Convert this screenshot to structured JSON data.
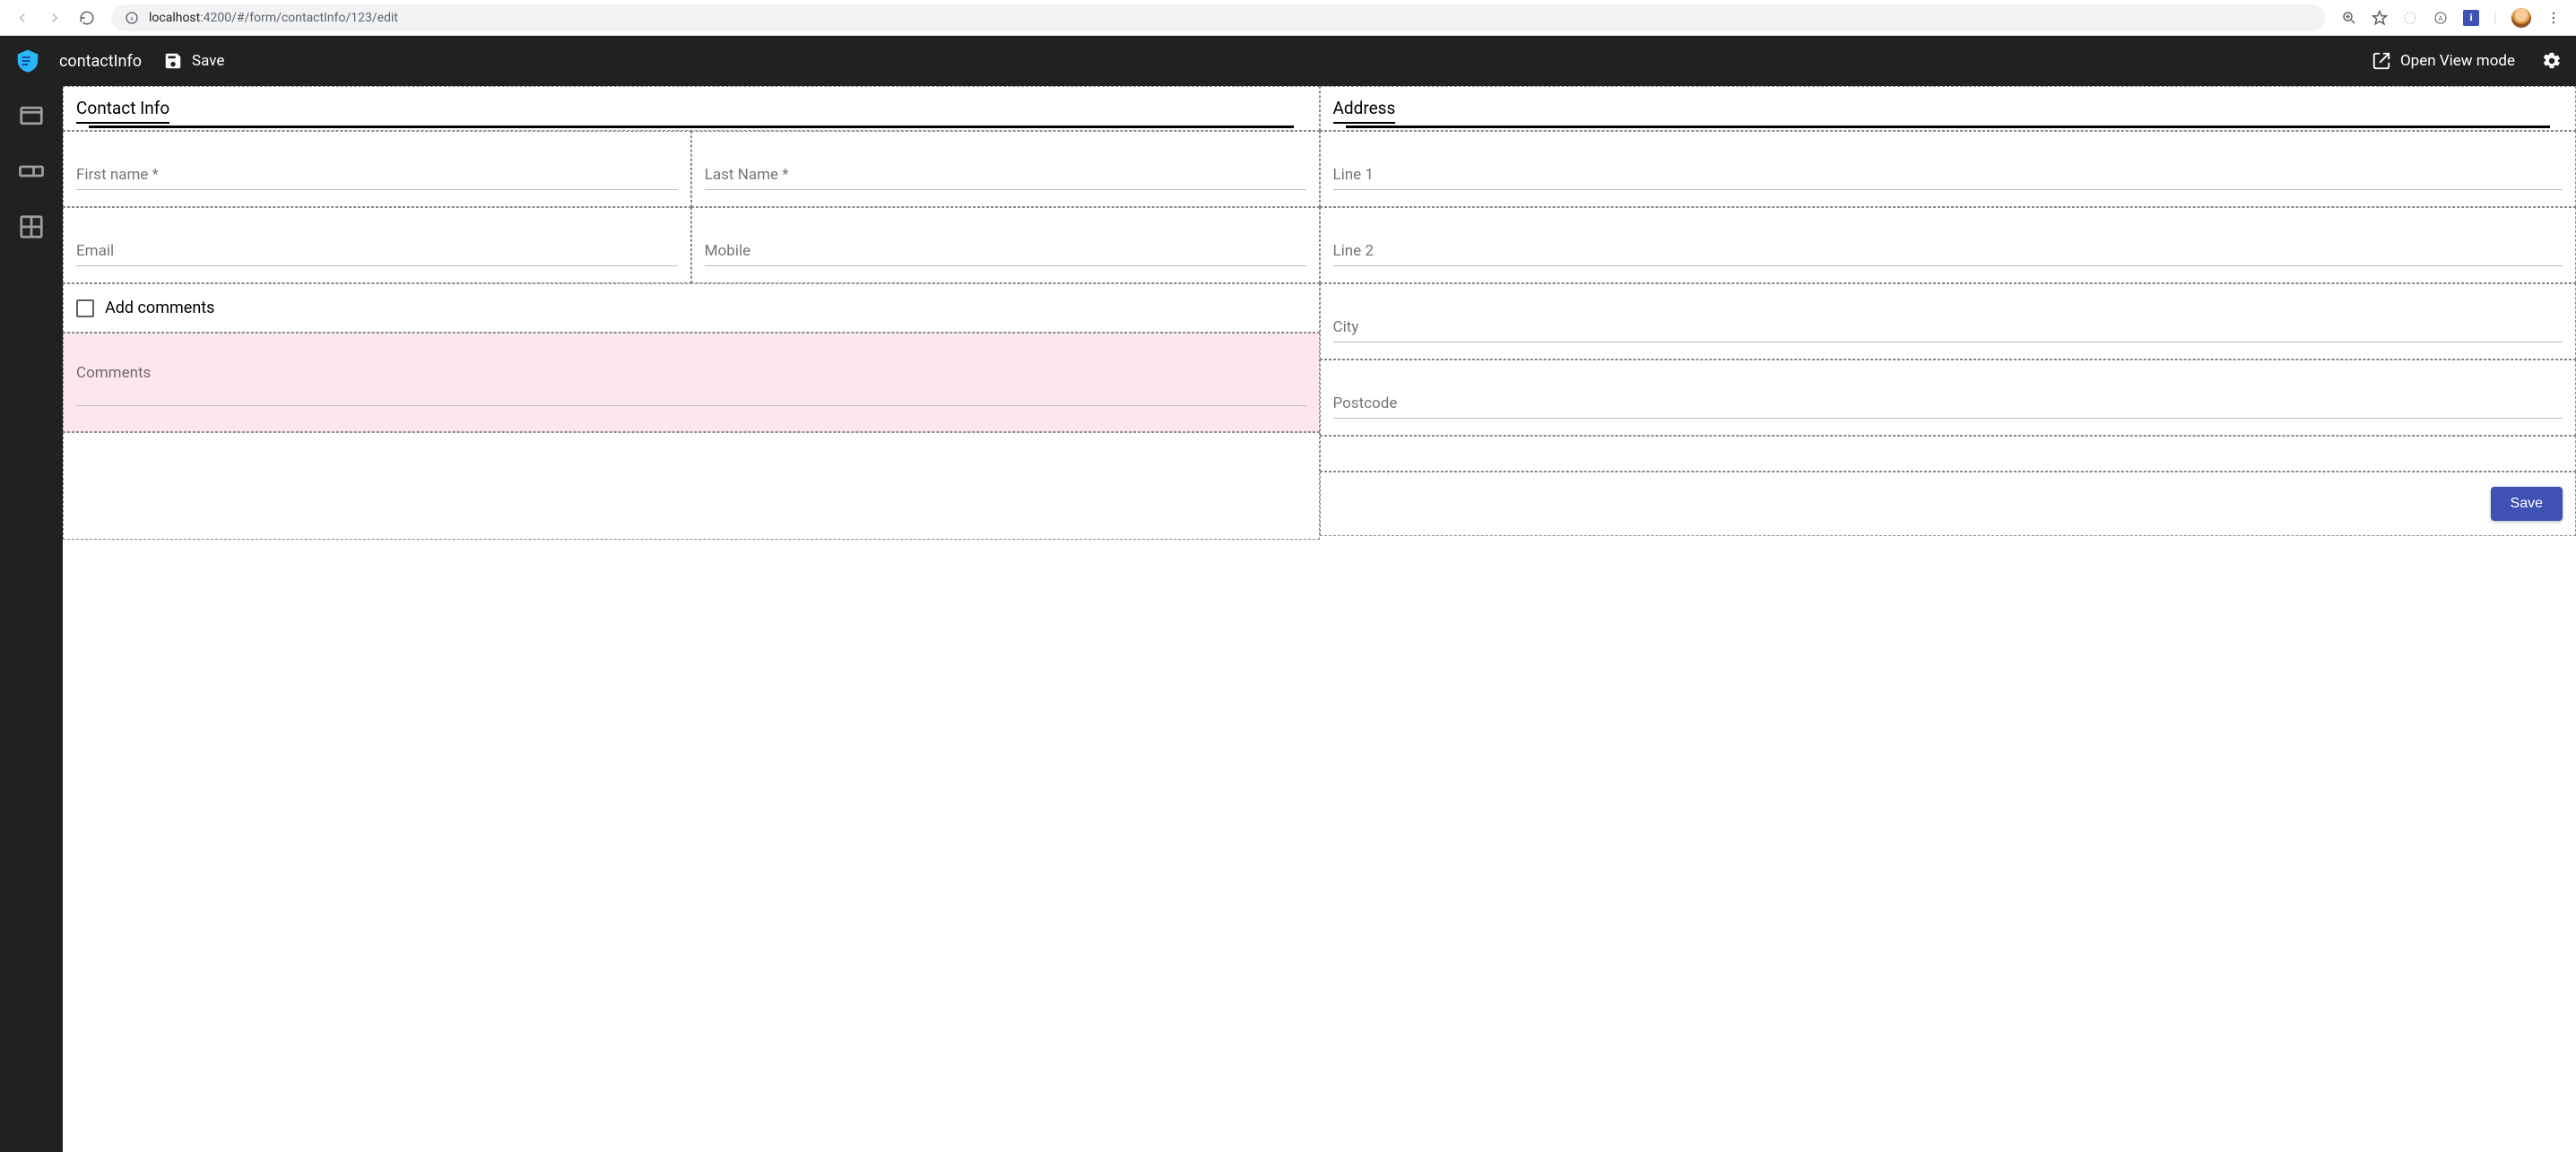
{
  "browser": {
    "url_host": "localhost",
    "url_port": ":4200",
    "url_path": "/#/form/contactInfo/123/edit"
  },
  "header": {
    "app_title": "contactInfo",
    "save_label": "Save",
    "open_view_label": "Open View mode"
  },
  "left_section": {
    "title": "Contact Info",
    "first_name_label": "First name *",
    "last_name_label": "Last Name *",
    "email_label": "Email",
    "mobile_label": "Mobile",
    "add_comments_label": "Add comments",
    "comments_label": "Comments"
  },
  "right_section": {
    "title": "Address",
    "line1_label": "Line 1",
    "line2_label": "Line 2",
    "city_label": "City",
    "postcode_label": "Postcode",
    "save_button_label": "Save"
  }
}
